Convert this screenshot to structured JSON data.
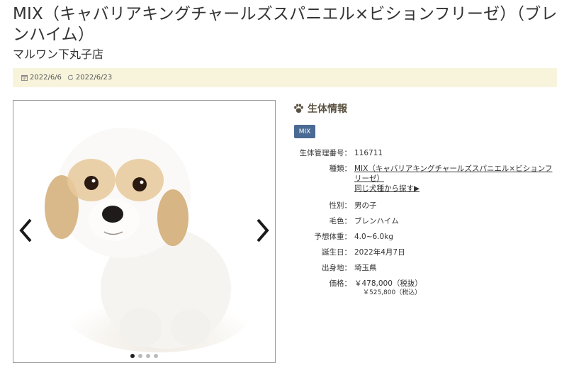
{
  "header": {
    "title": "MIX（キャバリアキングチャールズスパニエル×ビションフリーゼ）（ブレンハイム）",
    "shop": "マルワン下丸子店"
  },
  "dates": {
    "published": "2022/6/6",
    "updated": "2022/6/23",
    "published_icon": "calendar-icon",
    "updated_icon": "refresh-icon"
  },
  "gallery": {
    "prev_icon": "chevron-left-icon",
    "next_icon": "chevron-right-icon",
    "slide_count": 4,
    "active_slide": 1
  },
  "info": {
    "heading": "生体情報",
    "heading_icon": "paw-icon",
    "badge": "MIX",
    "rows": [
      {
        "label": "生体管理番号：",
        "value": "116711"
      },
      {
        "label": "種類：",
        "value": "MIX（キャバリアキングチャールズスパニエル×ビションフリーゼ）",
        "link2": "同じ犬種から探す▶"
      },
      {
        "label": "性別：",
        "value": "男の子"
      },
      {
        "label": "毛色：",
        "value": "ブレンハイム"
      },
      {
        "label": "予想体重：",
        "value": "4.0~6.0kg"
      },
      {
        "label": "誕生日：",
        "value": "2022年4月7日"
      },
      {
        "label": "出身地：",
        "value": "埼玉県"
      },
      {
        "label": "価格：",
        "value": "￥478,000（税抜）",
        "sub": "￥525,800（税込）"
      }
    ]
  },
  "colors": {
    "datebar": "#f8f4dc",
    "badge": "#4a6a93",
    "heading": "#5a5140"
  }
}
